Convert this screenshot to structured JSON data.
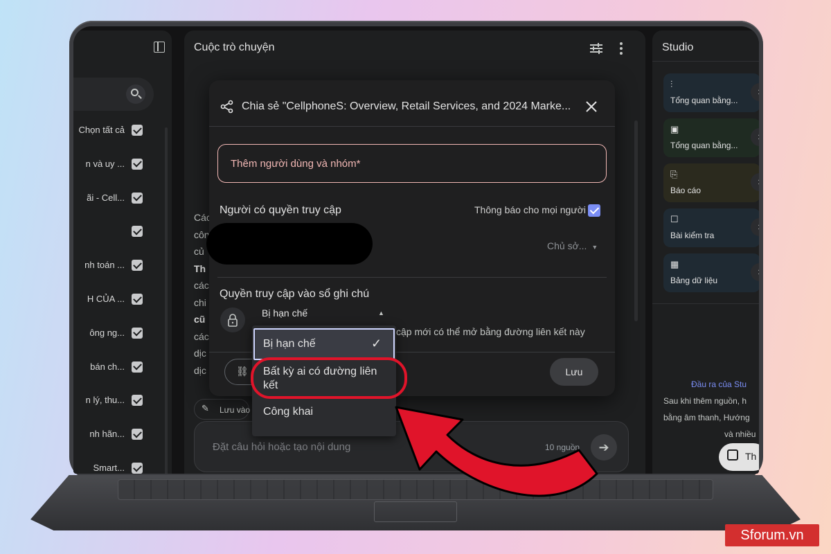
{
  "left": {
    "sources": [
      {
        "label": "Chọn tất cả"
      },
      {
        "label": "n và uy ..."
      },
      {
        "label": "ãi - Cell..."
      },
      {
        "label": ""
      },
      {
        "label": "nh toán ..."
      },
      {
        "label": "H CỦA ..."
      },
      {
        "label": "ông ng..."
      },
      {
        "label": "bán ch..."
      },
      {
        "label": "n lý, thu..."
      },
      {
        "label": "nh hãn..."
      },
      {
        "label": "Smart..."
      }
    ]
  },
  "center": {
    "title": "Cuộc trò chuyện",
    "bg_lines": [
      "Các",
      "côn",
      "củ",
      "Th",
      "các",
      "chi",
      "cũ",
      "các",
      "dịc",
      "dịc"
    ],
    "pin_label": "Lưu vào",
    "composer_placeholder": "Đặt câu hỏi hoặc tạo nội dung",
    "source_count": "10 nguồn"
  },
  "studio": {
    "title": "Studio",
    "cards": [
      {
        "label": "Tổng quan bằng...",
        "icon": "waveform-icon",
        "bg": "#1f2a33"
      },
      {
        "label": "Tổng quan bằng...",
        "icon": "video-icon",
        "bg": "#1f2b22"
      },
      {
        "label": "Báo cáo",
        "icon": "report-icon",
        "bg": "#2b2a1e"
      },
      {
        "label": "Bài kiểm tra",
        "icon": "quiz-icon",
        "bg": "#1f2a33"
      },
      {
        "label": "Bảng dữ liệu",
        "icon": "table-icon",
        "bg": "#1f2a33"
      }
    ],
    "output_title": "Đầu ra của Stu",
    "output_desc": [
      "Sau khi thêm nguồn, h",
      "bằng âm thanh, Hướng",
      "và nhiều"
    ],
    "note_button": "Th"
  },
  "dialog": {
    "title": "Chia sẻ \"CellphoneS: Overview, Retail Services, and 2024 Marke...",
    "add_placeholder": "Thêm người dùng và nhóm*",
    "access_heading": "Người có quyền truy cập",
    "notify_label": "Thông báo cho mọi người",
    "owner_role": "Chủ sở...",
    "notebook_access_heading": "Quyền truy cập vào sổ ghi chú",
    "access_value": "Bị hạn chế",
    "access_desc": "cập mới có thể mở bằng đường liên kết này",
    "save_label": "Lưu"
  },
  "menu": {
    "options": [
      "Bị hạn chế",
      "Bất kỳ ai có đường liên kết",
      "Công khai"
    ],
    "selected": "Bị hạn chế"
  },
  "watermark": "Sforum.vn",
  "colors": {
    "annotation": "#e0142a",
    "accent": "#7b8ef5"
  }
}
